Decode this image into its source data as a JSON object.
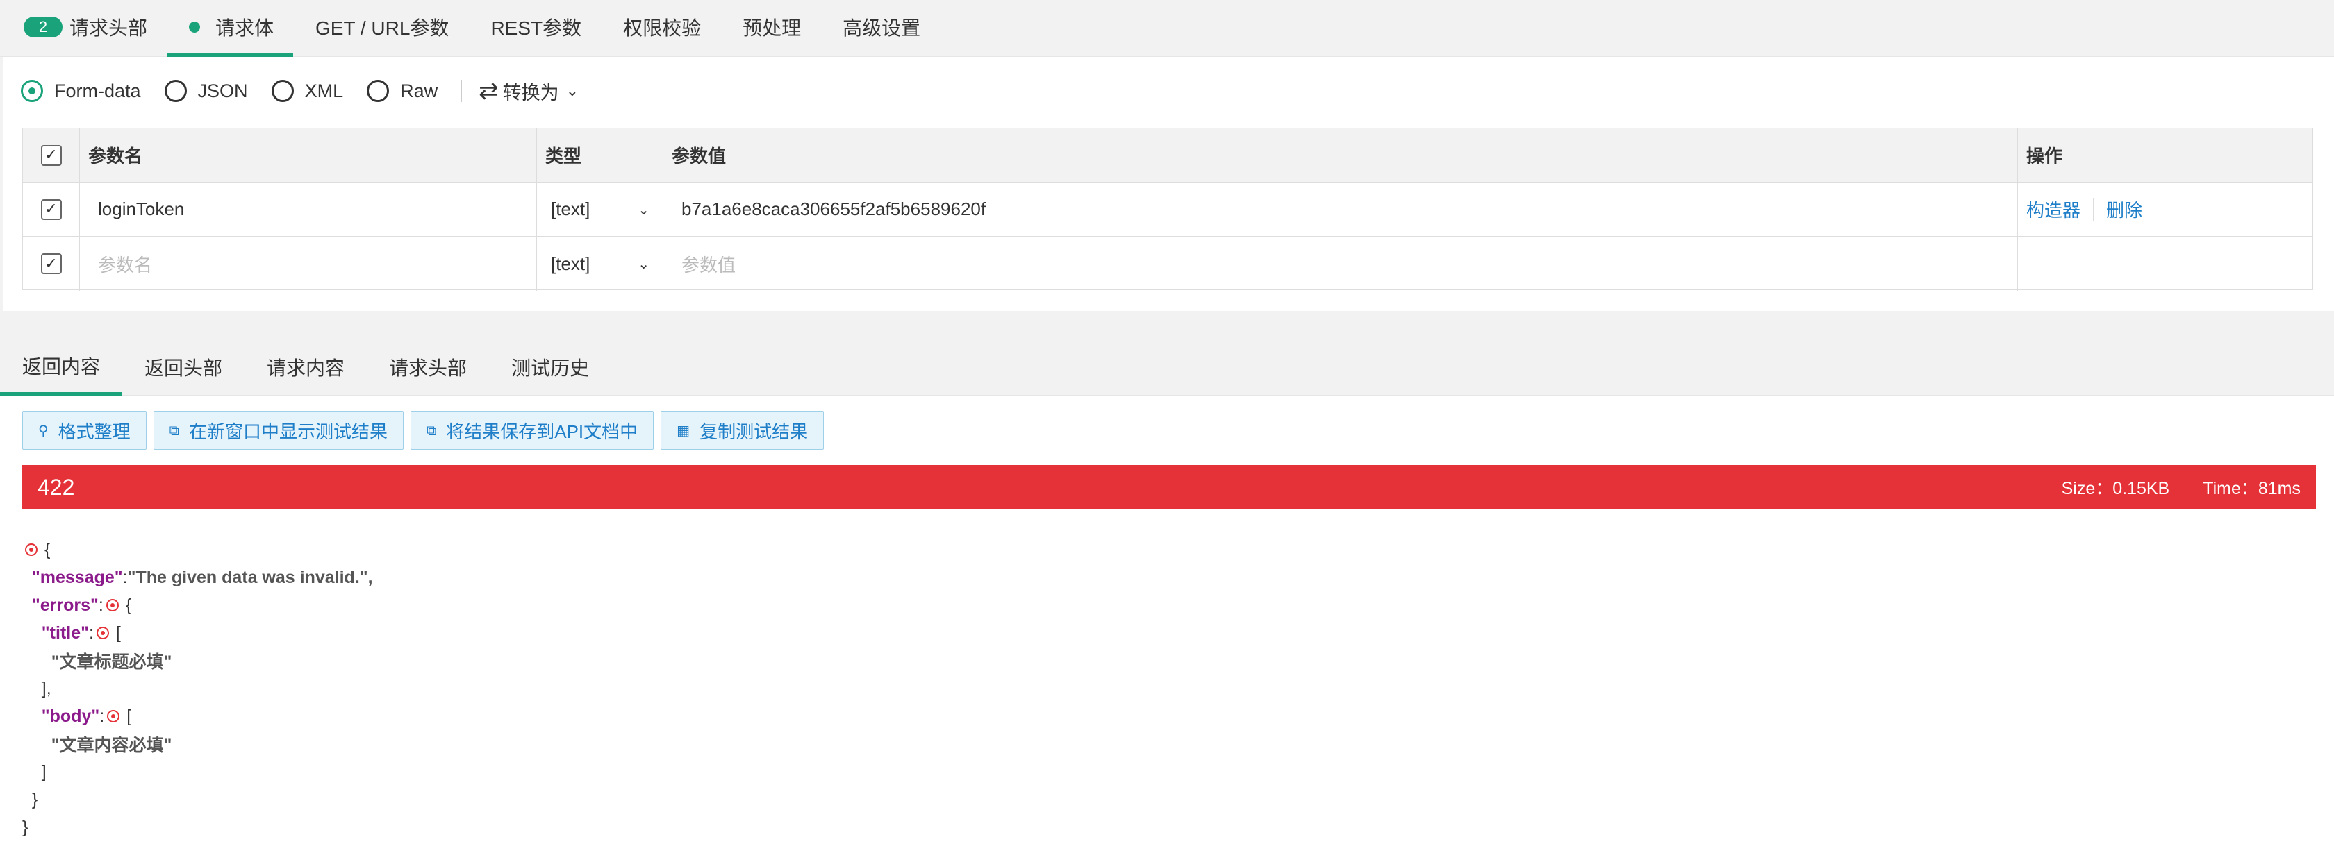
{
  "top_tabs": {
    "headers_count": "2",
    "headers": "请求头部",
    "body": "请求体",
    "get_url": "GET / URL参数",
    "rest": "REST参数",
    "auth": "权限校验",
    "preprocess": "预处理",
    "advanced": "高级设置"
  },
  "body_format": {
    "options": [
      "Form-data",
      "JSON",
      "XML",
      "Raw"
    ],
    "selected": "Form-data",
    "convert_label": "转换为"
  },
  "param_table": {
    "headers": {
      "name": "参数名",
      "type": "类型",
      "value": "参数值",
      "op": "操作"
    },
    "rows": [
      {
        "name": "loginToken",
        "type": "[text]",
        "value": "b7a1a6e8caca306655f2af5b6589620f",
        "op1": "构造器",
        "op2": "删除"
      }
    ],
    "new_row": {
      "name_placeholder": "参数名",
      "type": "[text]",
      "value_placeholder": "参数值"
    }
  },
  "result_tabs": {
    "content": "返回内容",
    "headers": "返回头部",
    "request_content": "请求内容",
    "request_headers": "请求头部",
    "history": "测试历史"
  },
  "actions": {
    "format": "格式整理",
    "new_window": "在新窗口中显示测试结果",
    "save_doc": "将结果保存到API文档中",
    "copy": "复制测试结果"
  },
  "status": {
    "code": "422",
    "size": "Size：0.15KB",
    "time": "Time：81ms",
    "color": "#e53238"
  },
  "json": {
    "open_brace": "{",
    "message_key": "\"message\"",
    "message_val": "\"The given data was invalid.\",",
    "errors_key": "\"errors\"",
    "title_key": "\"title\"",
    "title_item": "\"文章标题必填\"",
    "body_key": "\"body\"",
    "body_item": "\"文章内容必填\""
  },
  "accent_color": "#1aa37a",
  "link_color": "#1e7ec8"
}
